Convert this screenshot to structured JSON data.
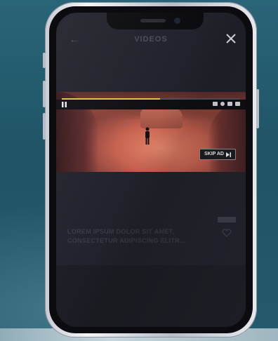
{
  "header": {
    "title": "VIDEOS"
  },
  "video": {
    "skip_ad_label": "SKIP AD",
    "progress": 0.55
  },
  "post": {
    "line1": "LOREM IPSUM DOLOR SIT AMET,",
    "line2": "CONSECTETUR ADIPISCING ELITR..."
  },
  "icons": {
    "back": "back-arrow-icon",
    "close": "close-icon",
    "pause": "pause-icon",
    "skip": "skip-next-icon",
    "heart": "heart-icon"
  },
  "colors": {
    "progress_accent": "#d9c44a",
    "background": "#22222c"
  }
}
